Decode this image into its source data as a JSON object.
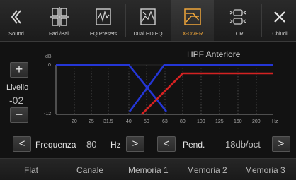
{
  "toolbar": {
    "tabs": [
      {
        "label": "Sound",
        "icon": "back-double-chevron-icon"
      },
      {
        "label": "Fad./Bal.",
        "icon": "fader-balance-icon"
      },
      {
        "label": "EQ Presets",
        "icon": "eq-presets-icon"
      },
      {
        "label": "Dual HD EQ",
        "icon": "dual-hd-eq-icon"
      },
      {
        "label": "X-OVER",
        "icon": "crossover-icon",
        "active": true
      },
      {
        "label": "TCR",
        "icon": "tcr-speakers-icon"
      },
      {
        "label": "Chiudi",
        "icon": "close-icon"
      }
    ]
  },
  "level": {
    "label": "Livello",
    "value": "-02",
    "plus": "+",
    "minus": "−"
  },
  "graph": {
    "title": "HPF Anteriore",
    "db_unit": "dB",
    "y_top": "0",
    "y_bottom": "-12",
    "x_labels": [
      "20",
      "25",
      "31.5",
      "40",
      "50",
      "63",
      "80",
      "100",
      "125",
      "160",
      "200"
    ],
    "x_unit": "Hz",
    "colors": {
      "blue": "#2436d6",
      "red": "#d42222",
      "guide": "#4a4a4a"
    }
  },
  "controls": {
    "freq_label": "Frequenza",
    "freq_value": "80",
    "freq_unit": "Hz",
    "slope_label": "Pend.",
    "slope_value": "18db/oct",
    "prev_symbol": "<",
    "next_symbol": ">"
  },
  "presets": [
    "Flat",
    "Canale",
    "Memoria 1",
    "Memoria 2",
    "Memoria 3"
  ],
  "accent": "#f0a63a"
}
